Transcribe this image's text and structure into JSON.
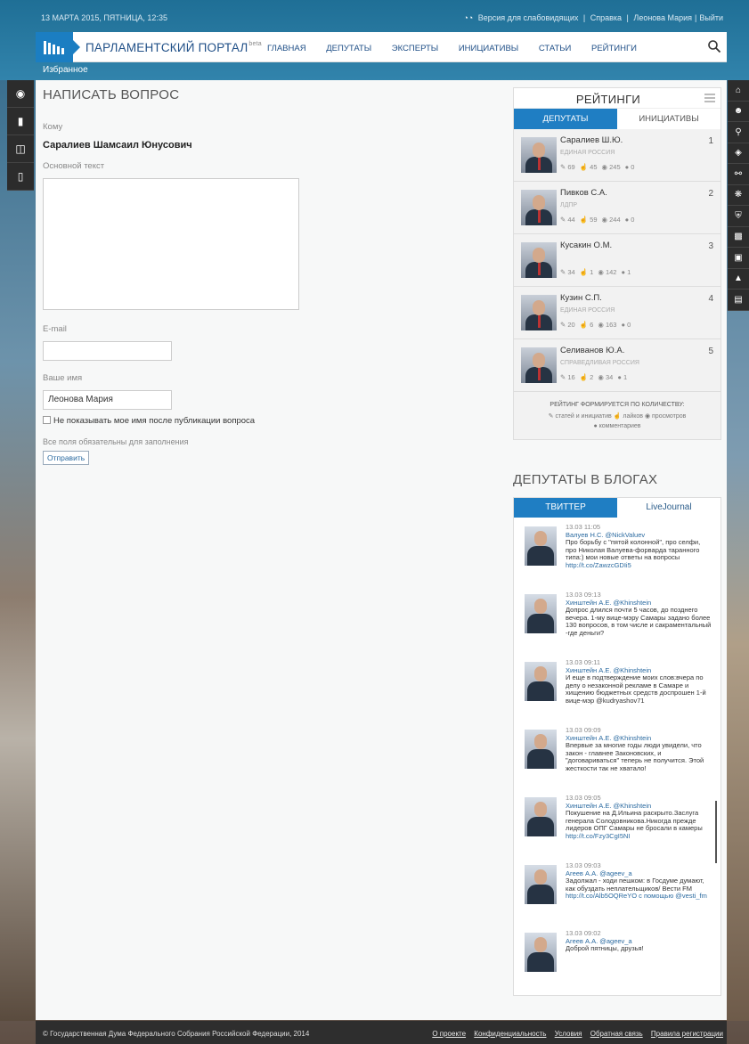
{
  "topbar": {
    "datetime": "13 МАРТА 2015, ПЯТНИЦА, 12:35",
    "accessibility": "Версия для слабовидящих",
    "help": "Справка",
    "user": "Леонова Мария",
    "logout": "Выйти"
  },
  "header": {
    "title": "ПАРЛАМЕНТСКИЙ ПОРТАЛ",
    "beta": "beta",
    "nav": [
      "ГЛАВНАЯ",
      "ДЕПУТАТЫ",
      "ЭКСПЕРТЫ",
      "ИНИЦИАТИВЫ",
      "СТАТЬИ",
      "РЕЙТИНГИ"
    ],
    "favorites": "Избранное"
  },
  "form": {
    "title": "НАПИСАТЬ ВОПРОС",
    "to_label": "Кому",
    "recipient": "Саралиев Шамсаил Юнусович",
    "body_label": "Основной текст",
    "email_label": "E-mail",
    "email_value": "",
    "name_label": "Ваше имя",
    "name_value": "Леонова Мария",
    "hide_name_label": "Не показывать мое имя после публикации вопроса",
    "required_note": "Все поля обязательны для заполнения",
    "submit": "Отправить"
  },
  "ratings": {
    "title": "РЕЙТИНГИ",
    "tabs": [
      "ДЕПУТАТЫ",
      "ИНИЦИАТИВЫ"
    ],
    "items": [
      {
        "name": "Саралиев Ш.Ю.",
        "party": "ЕДИНАЯ РОССИЯ",
        "articles": "69",
        "likes": "45",
        "views": "245",
        "comments": "0",
        "rank": "1"
      },
      {
        "name": "Пивков С.А.",
        "party": "ЛДПР",
        "articles": "44",
        "likes": "59",
        "views": "244",
        "comments": "0",
        "rank": "2"
      },
      {
        "name": "Кусакин О.М.",
        "party": "",
        "articles": "34",
        "likes": "1",
        "views": "142",
        "comments": "1",
        "rank": "3"
      },
      {
        "name": "Кузин С.П.",
        "party": "ЕДИНАЯ РОССИЯ",
        "articles": "20",
        "likes": "6",
        "views": "163",
        "comments": "0",
        "rank": "4"
      },
      {
        "name": "Селиванов Ю.А.",
        "party": "СПРАВЕДЛИВАЯ РОССИЯ",
        "articles": "16",
        "likes": "2",
        "views": "34",
        "comments": "1",
        "rank": "5"
      }
    ],
    "footer_title": "РЕЙТИНГ ФОРМИРУЕТСЯ ПО КОЛИЧЕСТВУ:",
    "footer_items": [
      "статей и инициатив",
      "лайков",
      "просмотров",
      "комментариев"
    ]
  },
  "blogs": {
    "title": "ДЕПУТАТЫ В БЛОГАХ",
    "tabs": [
      "ТВИТТЕР",
      "LiveJournal"
    ],
    "tweets": [
      {
        "time": "13.03 11:05",
        "user": "Валуев Н.С. @NickValuev",
        "text": "Про борьбу с \"пятой колонной\", про селфи, про Николая Валуева-форварда таранного типа:) мои новые ответы на вопросы ",
        "link": "http://t.co/ZawzcGDIi5"
      },
      {
        "time": "13.03 09:13",
        "user": "Хинштейн А.Е. @Khinshtein",
        "text": "Допрос длился почти 5 часов, до позднего вечера. 1-му вице-мэру Самары задано более 130 вопросов, в том числе и сакраментальный -где деньги?",
        "link": ""
      },
      {
        "time": "13.03 09:11",
        "user": "Хинштейн А.Е. @Khinshtein",
        "text": "И еще в подтверждение моих слов:вчера по делу о незаконной рекламе в Самаре и хищению бюджетных средств доспрошен 1-й вице-мэр @kudryashov71",
        "link": ""
      },
      {
        "time": "13.03 09:09",
        "user": "Хинштейн А.Е. @Khinshtein",
        "text": "Впервые за многие годы люди увидели, что закон - главнее Законовских, и \"договариваться\" теперь не получится. Этой жесткости так не хватало!",
        "link": ""
      },
      {
        "time": "13.03 09:05",
        "user": "Хинштейн А.Е. @Khinshtein",
        "text": "Покушение на Д.Ильина раскрыто.Заслуга генерала Солодовникова.Никогда прежде лидеров ОПГ Самары не бросали в камеры ",
        "link": "http://t.co/Fzy3CgI5NI"
      },
      {
        "time": "13.03 09:03",
        "user": "Агеев А.А. @ageev_a",
        "text": "Задолжал - ходи пешком: в Госдуме думают, как обуздать неплательщиков/ Вести FM ",
        "link": "http://t.co/Alb5OQReYO с помощью @vesti_fm"
      },
      {
        "time": "13.03 09:02",
        "user": "Агеев А.А. @ageev_a",
        "text": "Доброй пятницы, друзья!",
        "link": ""
      }
    ]
  },
  "footer": {
    "copyright": "© Государственная Дума Федерального Собрания Российской Федерации, 2014",
    "links": [
      "О проекте",
      "Конфиденциальность",
      "Условия",
      "Обратная связь",
      "Правила регистрации"
    ]
  },
  "colors": {
    "accent": "#1f7ec3",
    "title": "#1f4f87",
    "footer": "#2e2e2e"
  }
}
